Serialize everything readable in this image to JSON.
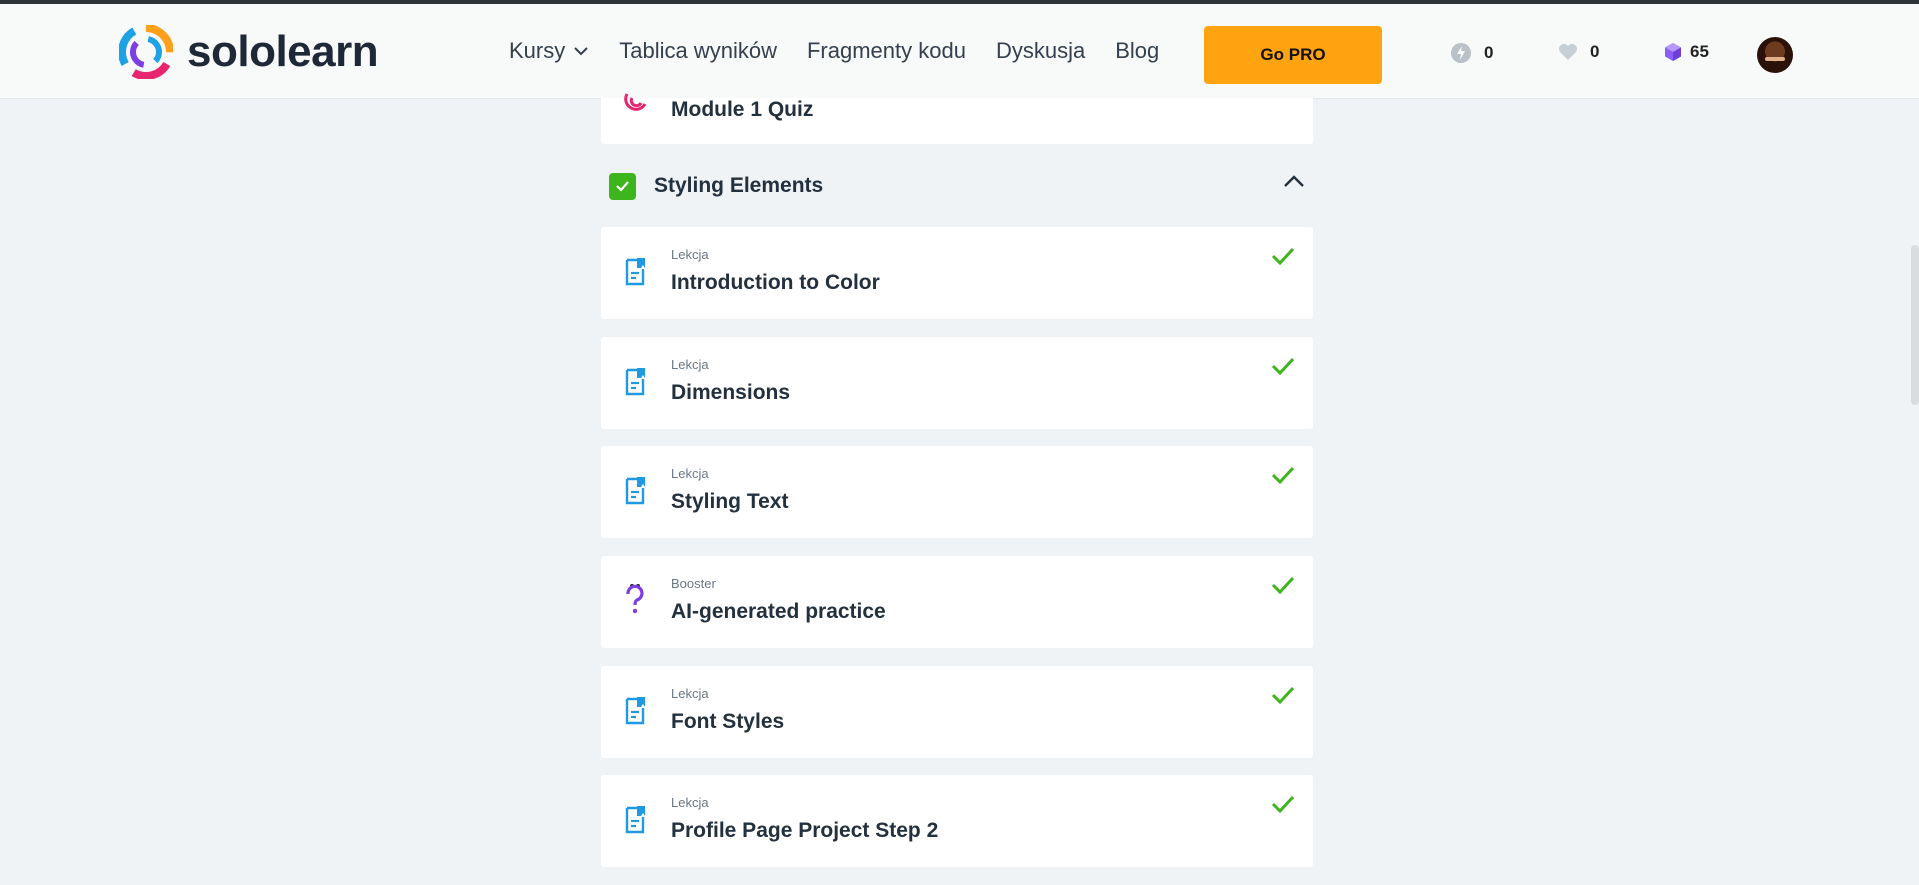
{
  "header": {
    "brand": "sololearn",
    "nav": [
      {
        "label": "Kursy",
        "has_dropdown": true
      },
      {
        "label": "Tablica wyników"
      },
      {
        "label": "Fragmenty kodu"
      },
      {
        "label": "Dyskusja"
      },
      {
        "label": "Blog"
      }
    ],
    "pro_button": "Go PRO",
    "stats": {
      "streak": "0",
      "hearts": "0",
      "gems": "65"
    }
  },
  "content": {
    "previous_item": {
      "title": "Module 1 Quiz"
    },
    "section": {
      "title": "Styling Elements",
      "completed": true,
      "expanded": true
    },
    "items": [
      {
        "category": "Lekcja",
        "title": "Introduction to Color",
        "icon": "lesson-icon",
        "completed": true
      },
      {
        "category": "Lekcja",
        "title": "Dimensions",
        "icon": "lesson-icon",
        "completed": true
      },
      {
        "category": "Lekcja",
        "title": "Styling Text",
        "icon": "lesson-icon",
        "completed": true
      },
      {
        "category": "Booster",
        "title": "AI-generated practice",
        "icon": "question-mark-icon",
        "completed": true
      },
      {
        "category": "Lekcja",
        "title": "Font Styles",
        "icon": "lesson-icon",
        "completed": true
      },
      {
        "category": "Lekcja",
        "title": "Profile Page Project Step 2",
        "icon": "lesson-icon",
        "completed": true
      }
    ]
  },
  "colors": {
    "accent_pro": "#ffa310",
    "check_green": "#3db51d",
    "lesson_blue": "#1f9ae0",
    "booster_purple": "#7b3fe4"
  }
}
